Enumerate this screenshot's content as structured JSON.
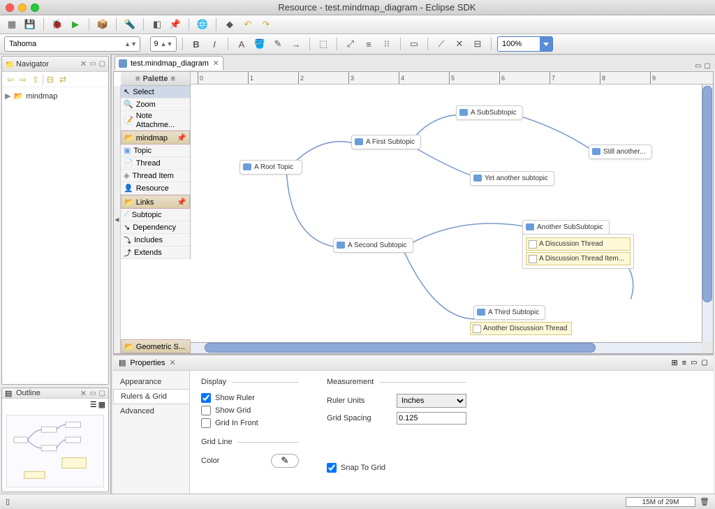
{
  "window": {
    "title": "Resource - test.mindmap_diagram - Eclipse SDK"
  },
  "toolbar": {
    "font": "Tahoma",
    "size": "9",
    "zoom": "100%"
  },
  "navigator": {
    "title": "Navigator",
    "root": "mindmap"
  },
  "outline": {
    "title": "Outline"
  },
  "editor": {
    "tab": "test.mindmap_diagram",
    "palette": {
      "title": "Palette",
      "tools": [
        "Select",
        "Zoom",
        "Note Attachme..."
      ],
      "group_mindmap": "mindmap",
      "mindmap_items": [
        "Topic",
        "Thread",
        "Thread Item",
        "Resource"
      ],
      "group_links": "Links",
      "links_items": [
        "Subtopic",
        "Dependency",
        "Includes",
        "Extends"
      ],
      "group_geo": "Geometric S..."
    },
    "nodes": {
      "root": "A Root Topic",
      "first": "A First Subtopic",
      "subsub": "A SubSubtopic",
      "still": "Still another...",
      "yet": "Yet another subtopic",
      "second": "A Second Subtopic",
      "another_sub": "Another SubSubtopic",
      "discussion_thread": "A Discussion Thread",
      "discussion_item": "A Discussion Thread Item...",
      "third": "A Third Subtopic",
      "another_disc": "Another Discussion Thread"
    },
    "ruler": {
      "marks": [
        "0",
        "1",
        "2",
        "3",
        "4",
        "5",
        "6",
        "7",
        "8",
        "9"
      ]
    }
  },
  "properties": {
    "title": "Properties",
    "tabs": {
      "appearance": "Appearance",
      "rulers": "Rulers & Grid",
      "advanced": "Advanced"
    },
    "display": {
      "label": "Display",
      "show_ruler": "Show Ruler",
      "show_ruler_val": true,
      "show_grid": "Show Grid",
      "show_grid_val": false,
      "grid_in_front": "Grid In Front",
      "grid_in_front_val": false
    },
    "measurement": {
      "label": "Measurement",
      "ruler_units": "Ruler Units",
      "ruler_units_val": "Inches",
      "grid_spacing": "Grid Spacing",
      "grid_spacing_val": "0.125"
    },
    "gridline": {
      "label": "Grid Line",
      "color": "Color"
    },
    "snap": {
      "label": "Snap To Grid",
      "val": true
    }
  },
  "status": {
    "heap": "15M of 29M"
  }
}
